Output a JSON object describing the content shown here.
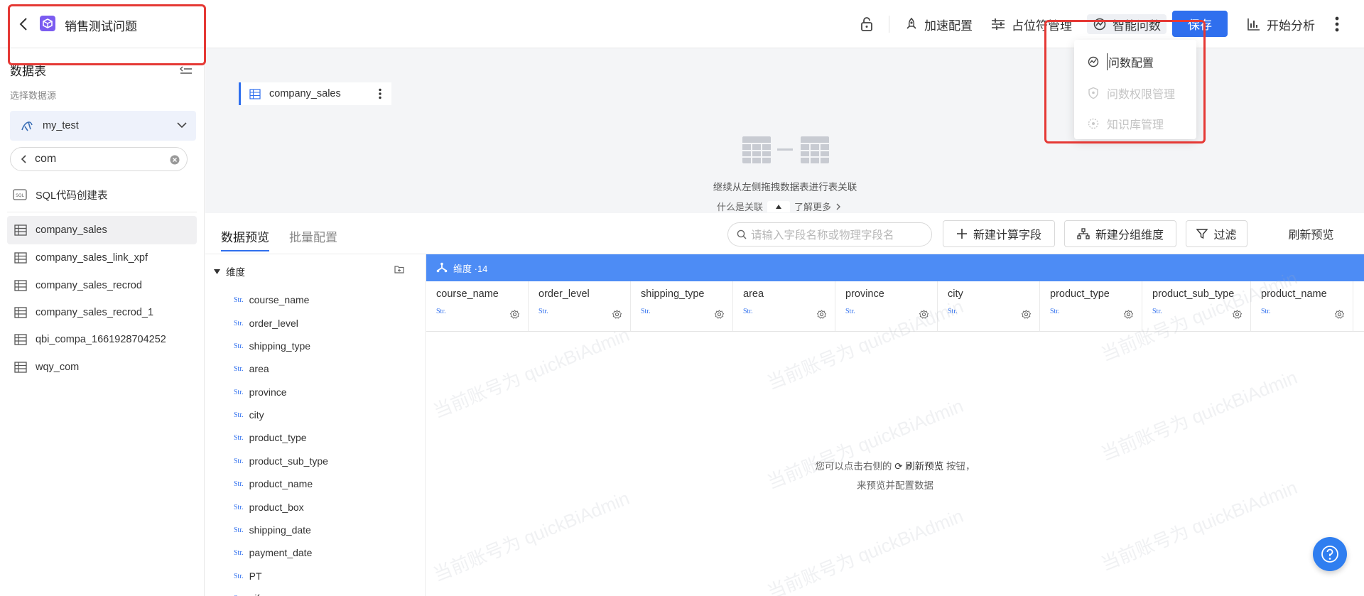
{
  "header": {
    "title": "销售测试问题",
    "actions": {
      "speed_config": "加速配置",
      "placeholder_mgmt": "占位符管理",
      "smart_query": "智能问数",
      "save": "保存",
      "start_analysis": "开始分析"
    }
  },
  "dropdown": {
    "items": [
      "问数配置",
      "问数权限管理",
      "知识库管理"
    ]
  },
  "sidebar": {
    "section_title": "数据表",
    "datasource_label": "选择数据源",
    "datasource_value": "my_test",
    "search_value": "com",
    "sql_create": "SQL代码创建表",
    "tables": [
      "company_sales",
      "company_sales_link_xpf",
      "company_sales_recrod",
      "company_sales_recrod_1",
      "qbi_compa_1661928704252",
      "wqy_com"
    ]
  },
  "canvas": {
    "table_card": "company_sales",
    "hint": "继续从左侧拖拽数据表进行表关联",
    "link_left": "什么是关联",
    "link_right": "了解更多"
  },
  "preview": {
    "tabs": [
      "数据预览",
      "批量配置"
    ],
    "search_placeholder": "请输入字段名称或物理字段名",
    "new_calc_field": "新建计算字段",
    "new_group_dim": "新建分组维度",
    "filter": "过滤",
    "refresh": "刷新预览",
    "dimension_group": "维度",
    "field_type": "Str.",
    "fields": [
      "course_name",
      "order_level",
      "shipping_type",
      "area",
      "province",
      "city",
      "product_type",
      "product_sub_type",
      "product_name",
      "product_box",
      "shipping_date",
      "payment_date",
      "PT",
      "pifa"
    ],
    "grid_header": "维度 ·14",
    "columns": [
      "course_name",
      "order_level",
      "shipping_type",
      "area",
      "province",
      "city",
      "product_type",
      "product_sub_type",
      "product_name"
    ],
    "empty_line1_pre": "您可以点击右侧的",
    "empty_line1_link": "刷新预览",
    "empty_line1_post": "按钮，",
    "empty_line2": "来预览并配置数据",
    "watermark": "当前账号为 quickBiAdmin"
  },
  "colors": {
    "primary": "#2f6fee",
    "highlight": "#e53935",
    "grid_header_bg": "#4d8cf5"
  }
}
